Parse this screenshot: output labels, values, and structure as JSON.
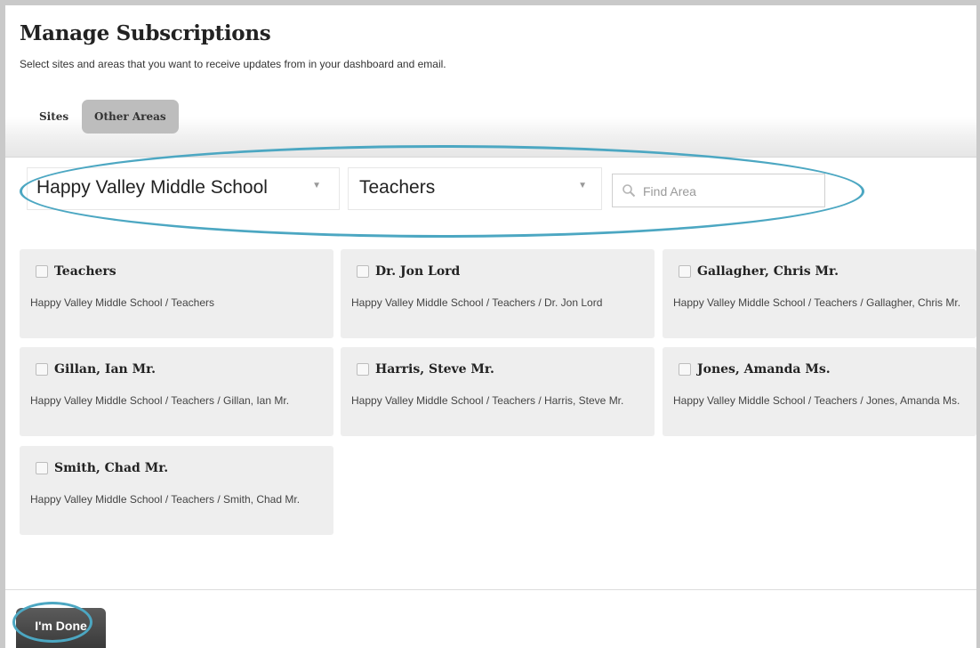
{
  "page": {
    "title": "Manage Subscriptions",
    "subtitle": "Select sites and areas that you want to receive updates from in your dashboard and email."
  },
  "tabs": [
    {
      "label": "Sites",
      "active": false
    },
    {
      "label": "Other Areas",
      "active": true
    }
  ],
  "filters": {
    "site_select": {
      "value": "Happy Valley Middle School"
    },
    "category_select": {
      "value": "Teachers"
    },
    "search": {
      "placeholder": "Find Area",
      "value": ""
    }
  },
  "areas": [
    {
      "name": "Teachers",
      "path": "Happy Valley Middle School / Teachers",
      "checked": false
    },
    {
      "name": "Dr. Jon Lord",
      "path": "Happy Valley Middle School / Teachers / Dr. Jon Lord",
      "checked": false
    },
    {
      "name": "Gallagher, Chris Mr.",
      "path": "Happy Valley Middle School / Teachers / Gallagher, Chris Mr.",
      "checked": false
    },
    {
      "name": "Gillan, Ian Mr.",
      "path": "Happy Valley Middle School / Teachers / Gillan, Ian Mr.",
      "checked": false
    },
    {
      "name": "Harris, Steve Mr.",
      "path": "Happy Valley Middle School / Teachers / Harris, Steve Mr.",
      "checked": false
    },
    {
      "name": "Jones, Amanda Ms.",
      "path": "Happy Valley Middle School / Teachers / Jones, Amanda Ms.",
      "checked": false
    },
    {
      "name": "Smith, Chad Mr.",
      "path": "Happy Valley Middle School / Teachers / Smith, Chad Mr.",
      "checked": false
    }
  ],
  "footer": {
    "done_label": "I'm Done"
  },
  "colors": {
    "highlight": "#4ca7c2",
    "card_bg": "#eeeeee",
    "active_tab_bg": "#bdbdbd",
    "done_button_bg": "#444444"
  }
}
